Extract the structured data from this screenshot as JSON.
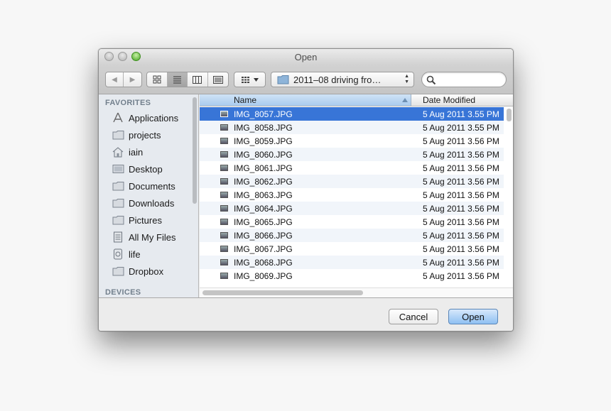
{
  "window": {
    "title": "Open"
  },
  "toolbar": {
    "back_glyph": "◀",
    "forward_glyph": "▶",
    "path_label": "2011–08 driving fro…",
    "search_placeholder": ""
  },
  "sidebar": {
    "favorites_header": "FAVORITES",
    "devices_header": "DEVICES",
    "items": [
      {
        "label": "Applications",
        "icon": "applications-icon"
      },
      {
        "label": "projects",
        "icon": "folder-icon"
      },
      {
        "label": "iain",
        "icon": "home-icon"
      },
      {
        "label": "Desktop",
        "icon": "desktop-icon"
      },
      {
        "label": "Documents",
        "icon": "folder-icon"
      },
      {
        "label": "Downloads",
        "icon": "folder-icon"
      },
      {
        "label": "Pictures",
        "icon": "folder-icon"
      },
      {
        "label": "All My Files",
        "icon": "all-files-icon"
      },
      {
        "label": "life",
        "icon": "archive-icon"
      },
      {
        "label": "Dropbox",
        "icon": "folder-icon"
      }
    ]
  },
  "filelist": {
    "columns": {
      "name": "Name",
      "date": "Date Modified"
    },
    "rows": [
      {
        "name": "IMG_8057.JPG",
        "date": "5 Aug 2011 3.55 PM",
        "selected": true
      },
      {
        "name": "IMG_8058.JPG",
        "date": "5 Aug 2011 3.55 PM"
      },
      {
        "name": "IMG_8059.JPG",
        "date": "5 Aug 2011 3.56 PM"
      },
      {
        "name": "IMG_8060.JPG",
        "date": "5 Aug 2011 3.56 PM"
      },
      {
        "name": "IMG_8061.JPG",
        "date": "5 Aug 2011 3.56 PM"
      },
      {
        "name": "IMG_8062.JPG",
        "date": "5 Aug 2011 3.56 PM"
      },
      {
        "name": "IMG_8063.JPG",
        "date": "5 Aug 2011 3.56 PM"
      },
      {
        "name": "IMG_8064.JPG",
        "date": "5 Aug 2011 3.56 PM"
      },
      {
        "name": "IMG_8065.JPG",
        "date": "5 Aug 2011 3.56 PM"
      },
      {
        "name": "IMG_8066.JPG",
        "date": "5 Aug 2011 3.56 PM"
      },
      {
        "name": "IMG_8067.JPG",
        "date": "5 Aug 2011 3.56 PM"
      },
      {
        "name": "IMG_8068.JPG",
        "date": "5 Aug 2011 3.56 PM"
      },
      {
        "name": "IMG_8069.JPG",
        "date": "5 Aug 2011 3.56 PM"
      }
    ]
  },
  "buttons": {
    "cancel": "Cancel",
    "open": "Open"
  },
  "colors": {
    "selection": "#3875d7",
    "accent_button": "#8fc0f2"
  }
}
